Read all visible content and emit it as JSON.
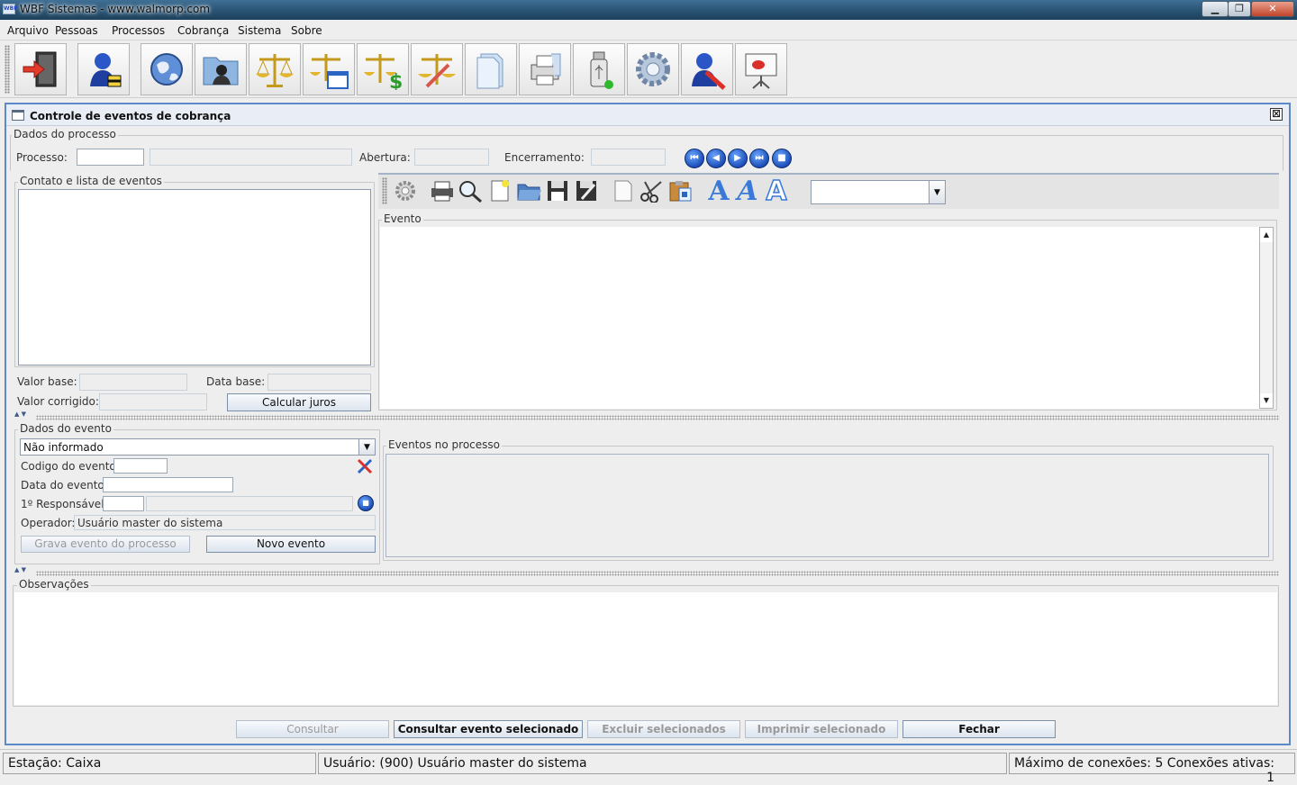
{
  "window": {
    "title": "WBF Sistemas - www.walmorp.com",
    "app_icon_text": "WBF",
    "minimize": "▁",
    "maximize": "❐",
    "close": "✕"
  },
  "menu": [
    "Arquivo",
    "Pessoas",
    "Processos",
    "Cobrança",
    "Sistema",
    "Sobre"
  ],
  "toolbar_icons": [
    "exit-door-icon",
    "user-admin-icon",
    "globe-icon",
    "contacts-folder-icon",
    "scales-justice-icon",
    "scales-window-icon",
    "scales-money-icon",
    "scales-edit-icon",
    "documents-icon",
    "printer-icon",
    "usb-drive-icon",
    "settings-gear-icon",
    "user-tools-icon",
    "presentation-icon"
  ],
  "frame": {
    "title": "Controle de eventos de cobrança",
    "close": "⊠"
  },
  "process": {
    "group_label": "Dados do processo",
    "processo_label": "Processo:",
    "abertura_label": "Abertura:",
    "encerramento_label": "Encerramento:",
    "nav": [
      "⏮",
      "◀",
      "▶",
      "⏭",
      "■"
    ]
  },
  "contact": {
    "group_label": "Contato e lista de eventos",
    "valor_base_label": "Valor base:",
    "data_base_label": "Data base:",
    "valor_corrigido_label": "Valor corrigido:",
    "calcular_button": "Calcular juros"
  },
  "editor": {
    "event_label": "Evento",
    "font_letters": [
      "A",
      "A",
      "A"
    ]
  },
  "event_data": {
    "group_label": "Dados do evento",
    "type_selected": "Não informado",
    "codigo_label": "Codigo do evento:",
    "data_label": "Data do evento:",
    "responsavel_label": "1º Responsável:",
    "operador_label": "Operador:",
    "operador_value": "Usuário master do sistema",
    "grava_button": "Grava evento do processo",
    "novo_button": "Novo evento"
  },
  "events_list": {
    "group_label": "Eventos no processo"
  },
  "observacoes": {
    "group_label": "Observações"
  },
  "actions": {
    "consultar": "Consultar",
    "consultar_evento": "Consultar evento selecionado",
    "excluir": "Excluir selecionados",
    "imprimir": "Imprimir selecionado",
    "fechar": "Fechar"
  },
  "status": {
    "estacao": "Estação: Caixa",
    "usuario": "Usuário: (900) Usuário master do sistema",
    "conexoes": "Máximo de conexões: 5 Conexões ativas: 1"
  },
  "colors": {
    "frame_border": "#5d89c9",
    "nav_blue": "#1d4fb8",
    "title_bar": "#27506f"
  }
}
